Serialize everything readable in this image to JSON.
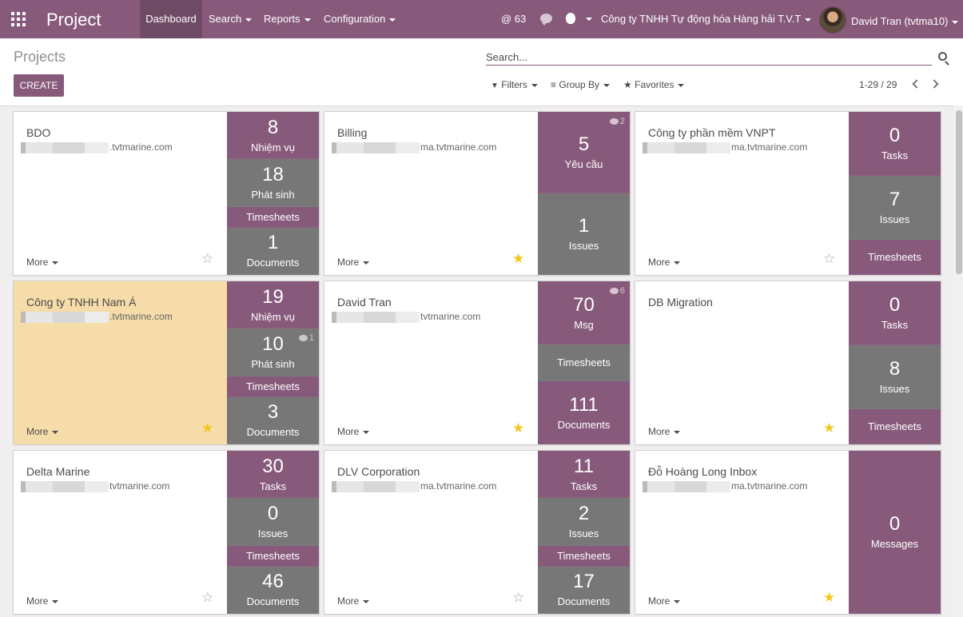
{
  "topbar": {
    "brand": "Project",
    "menu": [
      "Dashboard",
      "Search",
      "Reports",
      "Configuration"
    ],
    "mentions": "@ 63",
    "company": "Công ty TNHH Tự động hóa Hàng hải T.V.T",
    "user": "David Tran (tvtma10)",
    "colors": {
      "primary": "#875a7b",
      "primary_dark": "#6e4a64",
      "tile_gray": "#777777",
      "favorite": "#f3c71b"
    }
  },
  "control": {
    "breadcrumb": "Projects",
    "create_label": "CREATE",
    "search_placeholder": "Search...",
    "filters_label": "Filters",
    "groupby_label": "Group By",
    "favorites_label": "Favorites",
    "pager": "1-29 / 29"
  },
  "common": {
    "more_label": "More"
  },
  "cards": [
    {
      "title": "BDO",
      "email": ".tvtmarine.com",
      "favorite": false,
      "highlight": false,
      "tiles": [
        {
          "num": "8",
          "label": "Nhiệm vụ",
          "color": "purple"
        },
        {
          "num": "18",
          "label": "Phát sinh",
          "color": "gray"
        },
        {
          "num": "",
          "label": "Timesheets",
          "color": "purple"
        },
        {
          "num": "1",
          "label": "Documents",
          "color": "gray"
        }
      ]
    },
    {
      "title": "Billing",
      "email": "ma.tvtmarine.com",
      "favorite": true,
      "highlight": false,
      "tiles": [
        {
          "num": "5",
          "label": "Yêu cầu",
          "color": "purple",
          "badge": "2"
        },
        {
          "num": "1",
          "label": "Issues",
          "color": "gray"
        }
      ]
    },
    {
      "title": "Công ty phần mềm VNPT",
      "email": "ma.tvtmarine.com",
      "favorite": false,
      "highlight": false,
      "tiles": [
        {
          "num": "0",
          "label": "Tasks",
          "color": "purple"
        },
        {
          "num": "7",
          "label": "Issues",
          "color": "gray"
        },
        {
          "num": "",
          "label": "Timesheets",
          "color": "purple"
        }
      ]
    },
    {
      "title": "Công ty TNHH Nam Á",
      "email": ".tvtmarine.com",
      "favorite": true,
      "highlight": true,
      "tiles": [
        {
          "num": "19",
          "label": "Nhiệm vụ",
          "color": "purple"
        },
        {
          "num": "10",
          "label": "Phát sinh",
          "color": "gray",
          "badge": "1"
        },
        {
          "num": "",
          "label": "Timesheets",
          "color": "purple"
        },
        {
          "num": "3",
          "label": "Documents",
          "color": "gray"
        }
      ]
    },
    {
      "title": "David Tran",
      "email": "tvtmarine.com",
      "favorite": true,
      "highlight": false,
      "tiles": [
        {
          "num": "70",
          "label": "Msg",
          "color": "purple",
          "badge": "6"
        },
        {
          "num": "",
          "label": "Timesheets",
          "color": "gray"
        },
        {
          "num": "111",
          "label": "Documents",
          "color": "purple"
        }
      ]
    },
    {
      "title": "DB Migration",
      "email": "",
      "favorite": true,
      "highlight": false,
      "tiles": [
        {
          "num": "0",
          "label": "Tasks",
          "color": "purple"
        },
        {
          "num": "8",
          "label": "Issues",
          "color": "gray"
        },
        {
          "num": "",
          "label": "Timesheets",
          "color": "purple"
        }
      ]
    },
    {
      "title": "Delta Marine",
      "email": "tvtmarine.com",
      "favorite": false,
      "highlight": false,
      "tiles": [
        {
          "num": "30",
          "label": "Tasks",
          "color": "purple"
        },
        {
          "num": "0",
          "label": "Issues",
          "color": "gray"
        },
        {
          "num": "",
          "label": "Timesheets",
          "color": "purple"
        },
        {
          "num": "46",
          "label": "Documents",
          "color": "gray"
        }
      ]
    },
    {
      "title": "DLV Corporation",
      "email": "ma.tvtmarine.com",
      "favorite": false,
      "highlight": false,
      "tiles": [
        {
          "num": "11",
          "label": "Tasks",
          "color": "purple"
        },
        {
          "num": "2",
          "label": "Issues",
          "color": "gray"
        },
        {
          "num": "",
          "label": "Timesheets",
          "color": "purple"
        },
        {
          "num": "17",
          "label": "Documents",
          "color": "gray"
        }
      ]
    },
    {
      "title": "Đỗ Hoàng Long Inbox",
      "email": "ma.tvtmarine.com",
      "favorite": true,
      "highlight": false,
      "tiles": [
        {
          "num": "0",
          "label": "Messages",
          "color": "purple"
        }
      ]
    }
  ]
}
